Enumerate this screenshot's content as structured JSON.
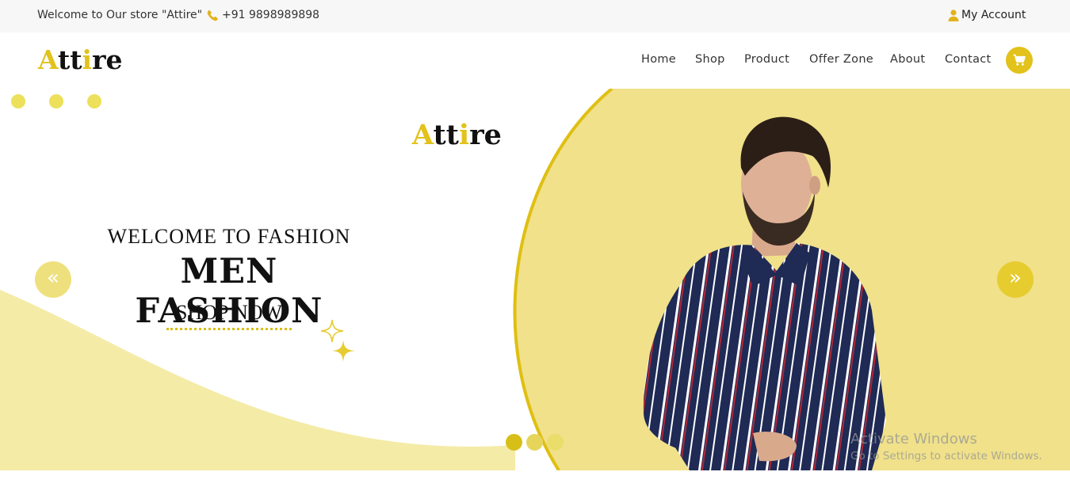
{
  "topbar": {
    "welcome": "Welcome to Our store \"Attire\"",
    "phone": "+91 9898989898",
    "account": "My Account",
    "icons": [
      "phone-icon",
      "user-icon"
    ]
  },
  "brand": {
    "logo_first": "A",
    "logo_mid": "tt",
    "logo_i": "i",
    "logo_end": "re",
    "accent_color": "#e2c21b",
    "light_yellow": "#f0e68c"
  },
  "nav": {
    "items": [
      "Home",
      "Shop",
      "Product",
      "Offer Zone",
      "About",
      "Contact"
    ],
    "cart_icon": "shopping-cart-icon"
  },
  "hero": {
    "subtitle": "WELCOME TO FASHION",
    "title": "MEN FASHION",
    "cta": "SHOP NOW",
    "prev_symbol": "«",
    "next_symbol": "»",
    "active_slide": 1,
    "slide_count": 3
  },
  "watermark": {
    "title": "Activate Windows",
    "subtitle": "Go to Settings to activate Windows."
  }
}
